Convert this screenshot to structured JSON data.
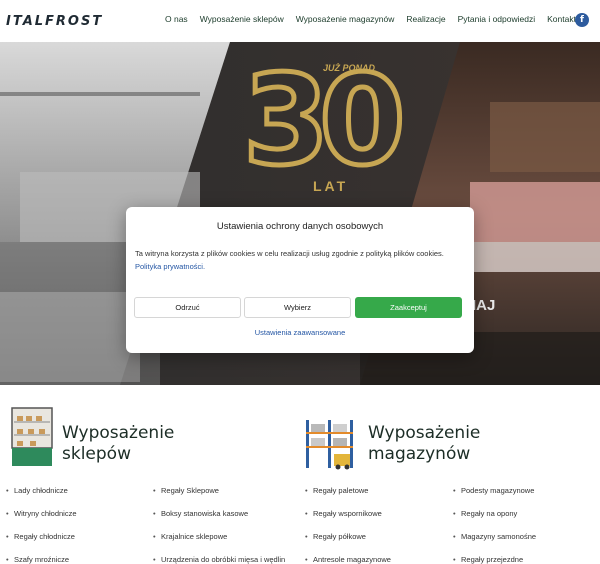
{
  "header": {
    "logo_text": "ITALFROST",
    "nav": [
      "O nas",
      "Wyposażenie sklepów",
      "Wyposażenie magazynów",
      "Realizacje",
      "Pytania i odpowiedzi",
      "Kontakt"
    ],
    "facebook_label": "f"
  },
  "hero": {
    "badge_prefix": "JUŻ PONAD",
    "badge_number": "30",
    "badge_suffix": "LAT",
    "store_sign": "IAJ"
  },
  "cookie": {
    "title": "Ustawienia ochrony danych osobowych",
    "text": "Ta witryna korzysta z plików cookies w celu realizacji usług zgodnie z polityką plików cookies.",
    "policy_link": "Polityka prywatności.",
    "deny_label": "Odrzuć",
    "choose_label": "Wybierz",
    "accept_label": "Zaakceptuj",
    "advanced_label": "Ustawienia zaawansowane"
  },
  "sections": {
    "shops": {
      "title_line1": "Wyposażenie",
      "title_line2": "sklepów",
      "col1": [
        "Lady chłodnicze",
        "Witryny chłodnicze",
        "Regały chłodnicze",
        "Szafy mroźnicze"
      ],
      "col2": [
        "Regały Sklepowe",
        "Boksy stanowiska kasowe",
        "Krajalnice sklepowe",
        "Urządzenia do obróbki mięsa i wędlin"
      ]
    },
    "warehouses": {
      "title_line1": "Wyposażenie",
      "title_line2": "magazynów",
      "col1": [
        "Regały paletowe",
        "Regały wspornikowe",
        "Regały półkowe",
        "Antresole magazynowe"
      ],
      "col2": [
        "Podesty magazynowe",
        "Regały na opony",
        "Magazyny samonośne",
        "Regały przejezdne"
      ]
    }
  },
  "colors": {
    "gold": "#c7a653",
    "accept_green": "#36a94a",
    "link_blue": "#2456a4",
    "facebook_blue": "#2d5b9e"
  }
}
